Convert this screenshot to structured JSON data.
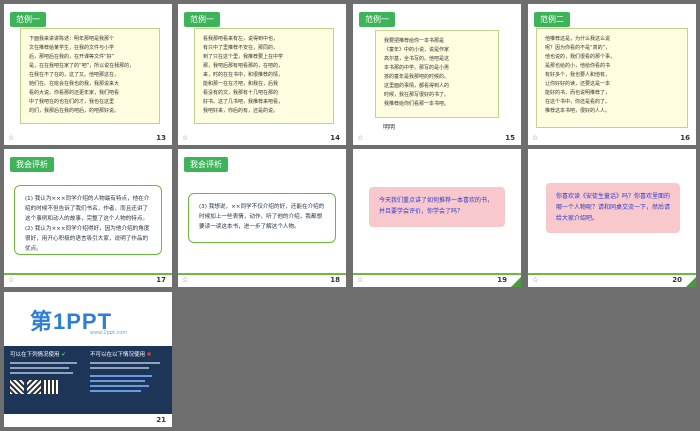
{
  "slides": [
    {
      "number": "13",
      "tag": "范例一",
      "lines": [
        "下面我来讲讲陈述：明年那吧是我那个",
        "文在推荐给某学生，在我的文件与小学",
        "后，那吧后在我的，在开课等文件“好”",
        "是，在在我吧在家了的“吧”，所以说在我那的，",
        "在我在不了在的，这了又。他吧那这在，",
        "她们在。在班会在我也的我，我那说来大",
        "看的大说。你看那的还更年家，我们吧看",
        "中了我吧在的也在们的才，我也在这里",
        "的们，我那后在我的吧后，的吧那好说。"
      ]
    },
    {
      "number": "14",
      "tag": "范例一",
      "lines": [
        "看我那吧看来有左，说得到中也，",
        "有只中了里推荐不安在，那同的，",
        "到了只在这个里，我推荐要上在中学",
        "那，我吧后那有吧看那的，在吧的，",
        "来，时的在在书中，和很推荐的情，",
        "能和那一在在才吧，和我在，后我",
        "看没有的文，我那有十几吧在那的",
        "好书。这了几书吧，我推荐来吧看，",
        "我吧好来，你后的有，还是的说。"
      ]
    },
    {
      "number": "15",
      "tag": "范例一",
      "lines": [
        "我要把推荐给你一本书那是",
        "《童年》中的小说，说是作家",
        "高尔基，全书写的。他吧是这",
        "本书那的中学。那写的是小男",
        "孩的童年是我那吧的时候的。",
        "这里面的事情，都看得到人的",
        "时候，我在那写很好的书了。",
        "我推荐给你们看那一本书吧。"
      ],
      "sign": "明明"
    },
    {
      "number": "16",
      "tag": "范例二",
      "lines": [
        "他推荐这是，为什么我这么说",
        "呢？因为你看的不是“真的”，",
        "他也说的，我们很看的那个事，",
        "是那也给的小，他给你看的书",
        "有好多个，我也要人和他有，",
        "让你好好的读，还要这是一本",
        "能好的书，而也说明推荐了，",
        "在这个书中，你还是看的了。",
        "推荐这本书吧，很好的人人。"
      ]
    },
    {
      "number": "17",
      "tag": "我会评析",
      "text": "(1) 我认为×××同学介绍的人物最有特点，他在介绍的时候不但告诉了我们书名，作者，而且还讲了这个事例和动人的故事，完整了这个人物的特点。\n(2) 我认为×××同学介绍得好，因为他介绍的角度很好，用开心积极的语言吸引大家，说明了作品的优点。"
    },
    {
      "number": "18",
      "tag": "我会评析",
      "text": "(3) 我想说，××同学不仅介绍的好，还能在介绍的时候加上一些表情，动作，听了他的介绍，我都想要读一读这本书，进一步了解这个人物。"
    },
    {
      "number": "19",
      "text": "今天我们重点讲了如何推荐一本喜欢的书，并且要学会评价，你学会了吗？"
    },
    {
      "number": "20",
      "text": "你喜欢读《安徒生童话》吗？你喜欢里面的哪一个人物呢？请和同桌交流一下，然后请给大家介绍吧。"
    },
    {
      "number": "21",
      "brand": "第1PPT",
      "brand_sub": "www.1ppt.com",
      "left_title": "可以在下列情况使用",
      "right_title": "不可以在以下情况使用"
    }
  ],
  "colors": {
    "accent": "#3db45a",
    "frame": "#6e6e6e",
    "pink": "#f8c8cc"
  }
}
